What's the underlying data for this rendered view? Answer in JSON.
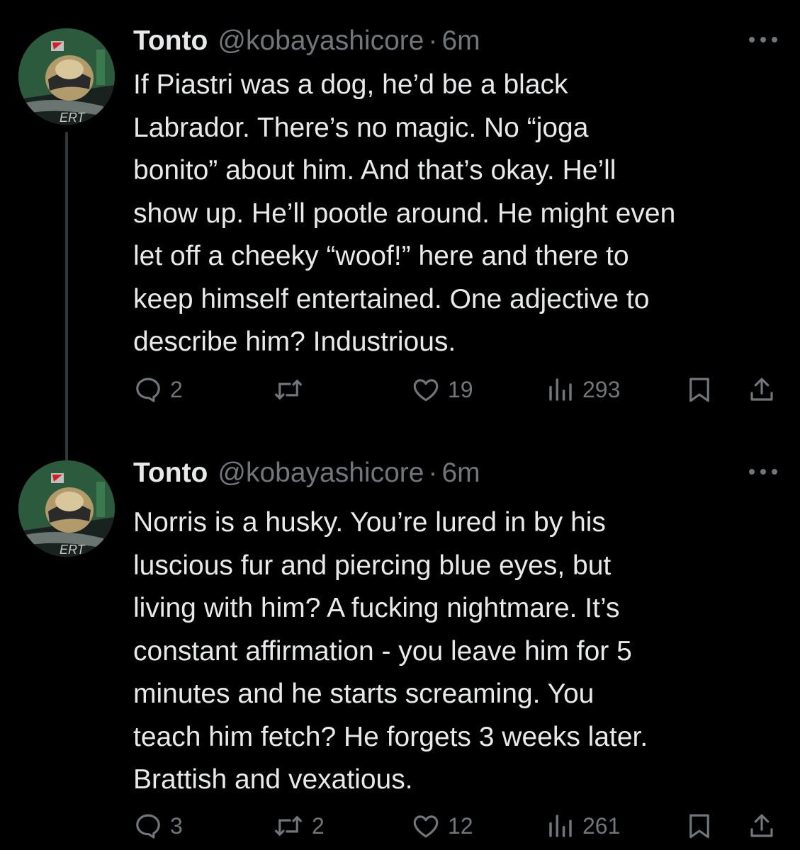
{
  "tweets": [
    {
      "name": "Tonto",
      "handle": "@kobayashicore",
      "separator": "·",
      "time": "6m",
      "text_lines": [
        "If Piastri was a dog, he’d be a black",
        "Labrador. There’s no magic. No “joga",
        "bonito” about him. And that’s okay. He’ll",
        "show up. He’ll pootle around. He might even",
        "let off a cheeky “woof!” here and there to",
        "keep himself entertained. One adjective to",
        "describe him? Industrious."
      ],
      "replies": "2",
      "reposts": "",
      "likes": "19",
      "views": "293"
    },
    {
      "name": "Tonto",
      "handle": "@kobayashicore",
      "separator": "·",
      "time": "6m",
      "text_lines": [
        "Norris is a husky. You’re lured in by his",
        "luscious fur and piercing blue eyes, but",
        "living with him? A fucking nightmare. It’s",
        "constant affirmation - you leave him for 5",
        "minutes and he starts screaming. You",
        "teach him fetch? He forgets 3 weeks later.",
        "Brattish and vexatious."
      ],
      "replies": "3",
      "reposts": "2",
      "likes": "12",
      "views": "261"
    }
  ],
  "icons": {
    "reply": "speech-bubble-icon",
    "repost": "repost-arrows-icon",
    "like": "heart-icon",
    "views": "bar-chart-icon",
    "bookmark": "bookmark-icon",
    "share": "share-upload-icon",
    "more": "more-dots-icon"
  },
  "colors": {
    "background": "#000000",
    "primary_text": "#e7e9ea",
    "secondary_text": "#71767b",
    "thread_line": "#333639"
  }
}
